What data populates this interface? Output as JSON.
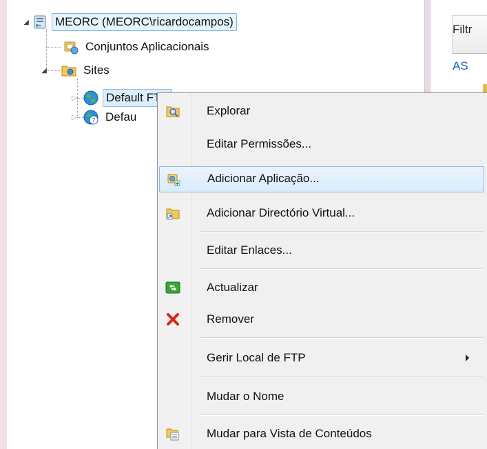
{
  "tree": {
    "root_label": "MEORC (MEORC\\ricardocampos)",
    "app_pools_label": "Conjuntos Aplicacionais",
    "sites_label": "Sites",
    "site_ftp_label": "Default FTP",
    "site_web_label": "Defau"
  },
  "right_panel": {
    "filter_label": "Filtr",
    "as_label": "AS"
  },
  "context_menu": {
    "items": [
      {
        "label": "Explorar",
        "icon": "explore-icon"
      },
      {
        "label": "Editar Permissões...",
        "icon": ""
      },
      {
        "label": "Adicionar Aplicação...",
        "icon": "add-application-icon",
        "highlighted": true
      },
      {
        "label": "Adicionar Directório Virtual...",
        "icon": "add-virtual-directory-icon"
      },
      {
        "label": "Editar Enlaces...",
        "icon": ""
      },
      {
        "label": "Actualizar",
        "icon": "refresh-icon"
      },
      {
        "label": "Remover",
        "icon": "remove-icon"
      },
      {
        "label": "Gerir Local de FTP",
        "icon": "",
        "submenu": true
      },
      {
        "label": "Mudar o Nome",
        "icon": ""
      },
      {
        "label": "Mudar para Vista de Conteúdos",
        "icon": "content-view-icon"
      }
    ]
  },
  "colors": {
    "highlight_border": "#8fb8e4",
    "selection_border": "#7eb4ea",
    "remove_red": "#d9261c",
    "refresh_green": "#3aa63a"
  }
}
